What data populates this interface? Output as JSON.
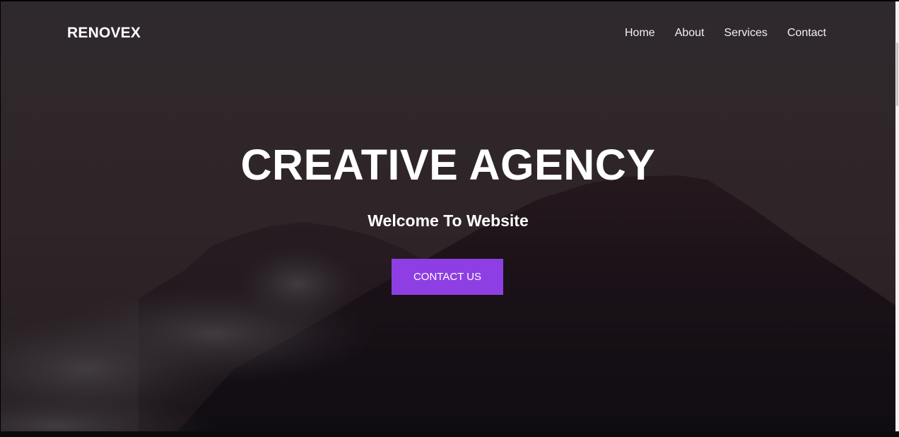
{
  "header": {
    "logo": "RENOVEX",
    "nav": [
      {
        "label": "Home"
      },
      {
        "label": "About"
      },
      {
        "label": "Services"
      },
      {
        "label": "Contact"
      }
    ]
  },
  "hero": {
    "title": "CREATIVE AGENCY",
    "subtitle": "Welcome To Website",
    "cta_label": "CONTACT US",
    "background": "mountain-landscape-photo"
  },
  "colors": {
    "accent": "#8e3fe3",
    "text": "#ffffff"
  }
}
